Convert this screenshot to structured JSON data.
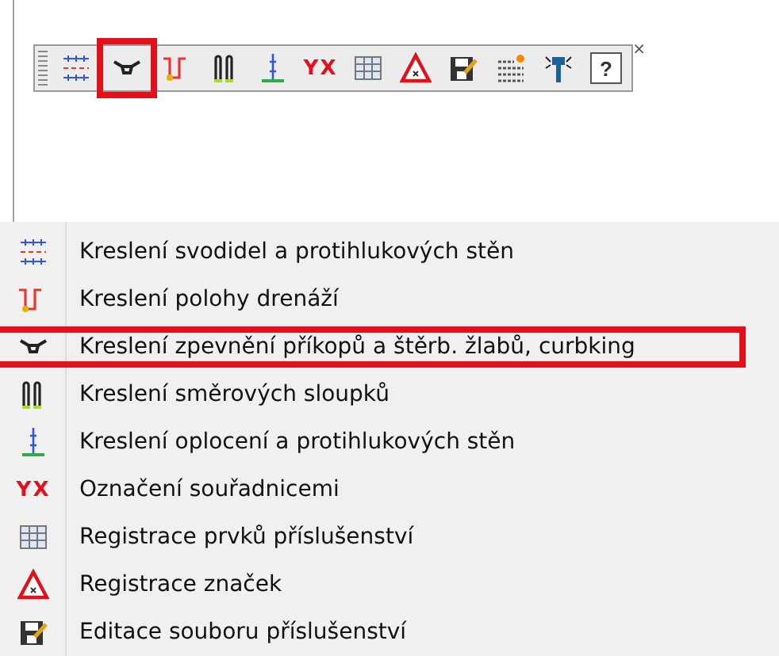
{
  "toolbar": {
    "close": "×",
    "buttons": [
      {
        "kind": "barrier",
        "selected": false
      },
      {
        "kind": "ditch",
        "selected": true
      },
      {
        "kind": "drain",
        "selected": false
      },
      {
        "kind": "posts",
        "selected": false
      },
      {
        "kind": "fence",
        "selected": false
      },
      {
        "kind": "coords",
        "glyph": "YX",
        "selected": false
      },
      {
        "kind": "grid",
        "selected": false
      },
      {
        "kind": "sign",
        "selected": false
      },
      {
        "kind": "edit",
        "selected": false
      },
      {
        "kind": "lines",
        "selected": false
      },
      {
        "kind": "tool",
        "selected": false
      },
      {
        "kind": "help",
        "glyph": "?",
        "selected": false
      }
    ]
  },
  "menu": {
    "items": [
      {
        "kind": "barrier",
        "label": "Kreslení svodidel a protihlukových stěn",
        "selected": false
      },
      {
        "kind": "drain",
        "label": "Kreslení polohy drenáží",
        "selected": false
      },
      {
        "kind": "ditch",
        "label": "Kreslení zpevnění příkopů a štěrb. žlabů, curbking",
        "selected": true
      },
      {
        "kind": "posts",
        "label": "Kreslení směrových sloupků",
        "selected": false
      },
      {
        "kind": "fence",
        "label": "Kreslení oplocení a protihlukových stěn",
        "selected": false
      },
      {
        "kind": "coords",
        "glyph": "YX",
        "label": "Označení souřadnicemi",
        "selected": false
      },
      {
        "kind": "grid",
        "label": "Registrace prvků příslušenství",
        "selected": false
      },
      {
        "kind": "sign",
        "label": "Registrace značek",
        "selected": false
      },
      {
        "kind": "edit",
        "label": "Editace souboru příslušenství",
        "selected": false
      }
    ]
  }
}
